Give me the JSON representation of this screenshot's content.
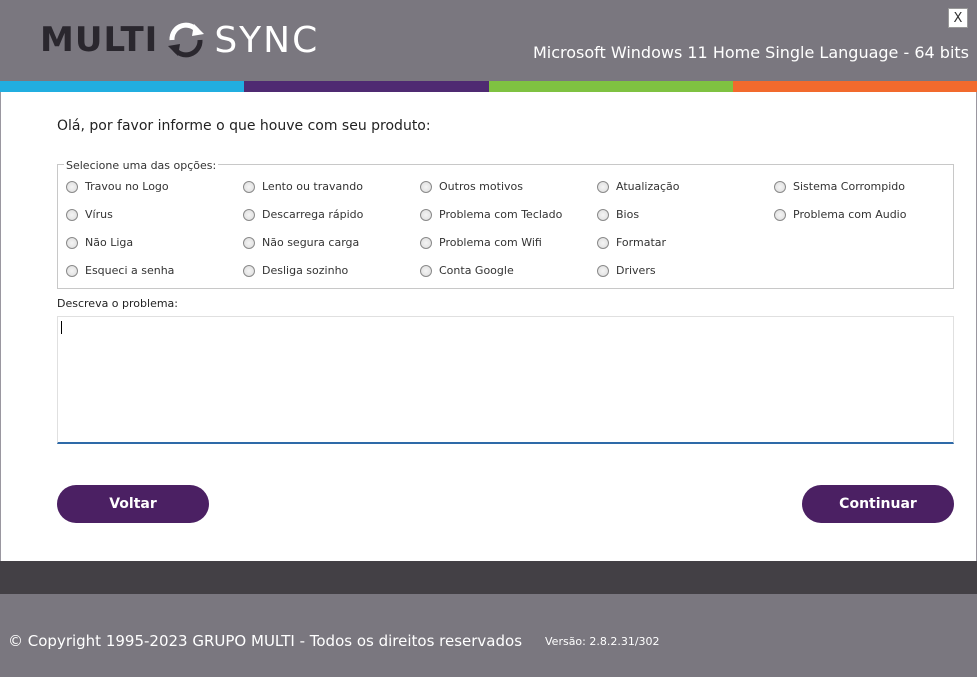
{
  "header": {
    "logo_left": "MULTI",
    "logo_right": "SYNC",
    "os_info": "Microsoft Windows 11 Home Single Language - 64 bits",
    "close_label": "X"
  },
  "color_strip": [
    "#21aee0",
    "#4f2a72",
    "#7fc241",
    "#f26a2d"
  ],
  "form": {
    "greeting": "Olá, por favor informe o que houve com seu produto:",
    "options_legend": "Selecione uma das opções:",
    "options": [
      [
        "Travou no Logo",
        "Lento ou travando",
        "Outros motivos",
        "Atualização",
        "Sistema Corrompido"
      ],
      [
        "Vírus",
        "Descarrega rápido",
        "Problema com Teclado",
        "Bios",
        "Problema com Audio"
      ],
      [
        "Não Liga",
        "Não segura carga",
        "Problema com Wifi",
        "Formatar"
      ],
      [
        "Esqueci a senha",
        "Desliga sozinho",
        "Conta Google",
        "Drivers"
      ]
    ],
    "description_label": "Descreva o problema:",
    "description_value": ""
  },
  "buttons": {
    "back": "Voltar",
    "continue": "Continuar"
  },
  "footer": {
    "copyright": "© Copyright 1995-2023 GRUPO MULTI - Todos os direitos reservados",
    "version": "Versão: 2.8.2.31/302"
  }
}
